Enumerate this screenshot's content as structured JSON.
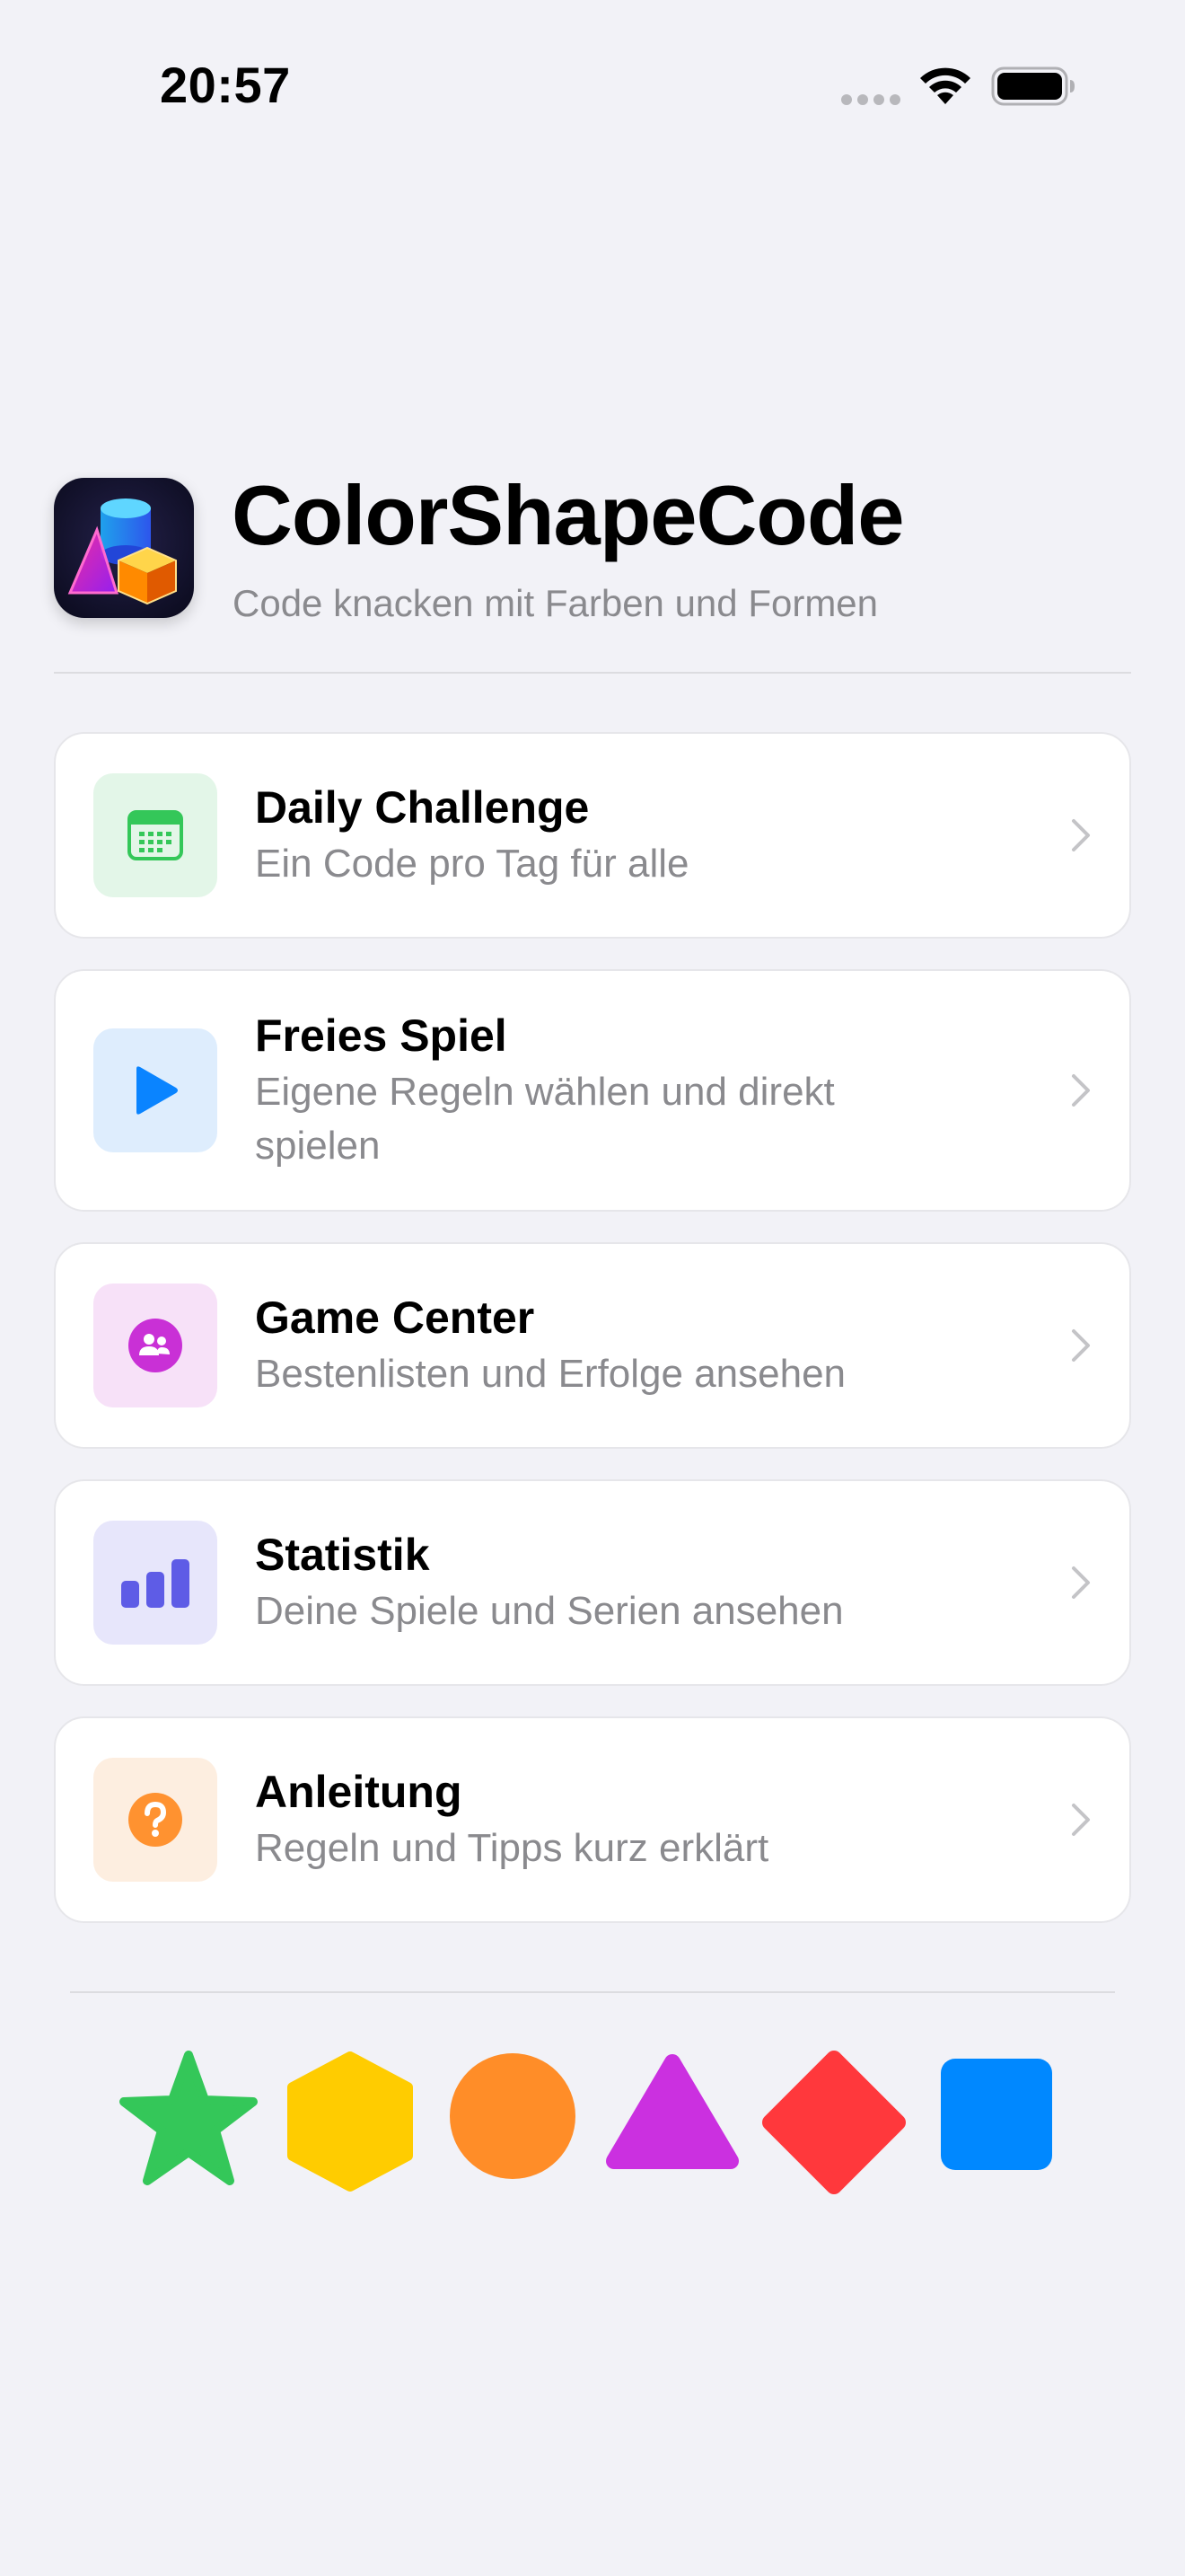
{
  "status_bar": {
    "time": "20:57"
  },
  "header": {
    "title": "ColorShapeCode",
    "subtitle": "Code knacken mit Farben und Formen"
  },
  "menu": {
    "items": [
      {
        "title": "Daily Challenge",
        "subtitle": "Ein Code pro Tag für alle",
        "icon": "calendar-icon",
        "icon_color": "#34c759",
        "icon_bg": "#e3f6e8"
      },
      {
        "title": "Freies Spiel",
        "subtitle": "Eigene Regeln wählen und direkt spielen",
        "icon": "play-icon",
        "icon_color": "#0a84ff",
        "icon_bg": "#deedfd"
      },
      {
        "title": "Game Center",
        "subtitle": "Bestenlisten und Erfolge ansehen",
        "icon": "game-center-icon",
        "icon_color": "#c930d6",
        "icon_bg": "#f7e1f8"
      },
      {
        "title": "Statistik",
        "subtitle": "Deine Spiele und Serien ansehen",
        "icon": "bar-chart-icon",
        "icon_color": "#5e5ce6",
        "icon_bg": "#e7e6fb"
      },
      {
        "title": "Anleitung",
        "subtitle": "Regeln und Tipps kurz erklärt",
        "icon": "question-icon",
        "icon_color": "#ff9230",
        "icon_bg": "#fdeee0"
      }
    ]
  },
  "shapes": [
    {
      "shape": "star",
      "color": "#34c759"
    },
    {
      "shape": "hexagon",
      "color": "#ffcc00"
    },
    {
      "shape": "circle",
      "color": "#ff8d28"
    },
    {
      "shape": "triangle",
      "color": "#cb30e0"
    },
    {
      "shape": "diamond",
      "color": "#ff383c"
    },
    {
      "shape": "square",
      "color": "#0088ff"
    }
  ]
}
